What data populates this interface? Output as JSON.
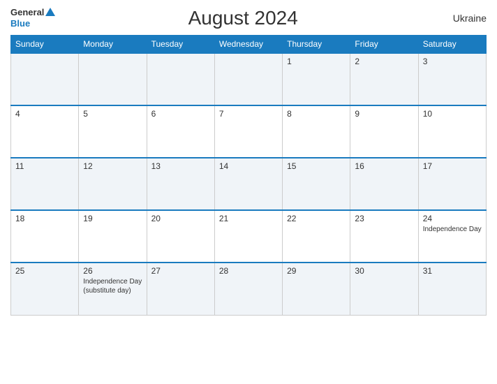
{
  "header": {
    "logo_general": "General",
    "logo_blue": "Blue",
    "title": "August 2024",
    "country": "Ukraine"
  },
  "days_of_week": [
    "Sunday",
    "Monday",
    "Tuesday",
    "Wednesday",
    "Thursday",
    "Friday",
    "Saturday"
  ],
  "weeks": [
    {
      "days": [
        {
          "num": "",
          "empty": true
        },
        {
          "num": "",
          "empty": true
        },
        {
          "num": "",
          "empty": true
        },
        {
          "num": "",
          "empty": true
        },
        {
          "num": "1",
          "event": ""
        },
        {
          "num": "2",
          "event": ""
        },
        {
          "num": "3",
          "event": ""
        }
      ]
    },
    {
      "days": [
        {
          "num": "4",
          "event": ""
        },
        {
          "num": "5",
          "event": ""
        },
        {
          "num": "6",
          "event": ""
        },
        {
          "num": "7",
          "event": ""
        },
        {
          "num": "8",
          "event": ""
        },
        {
          "num": "9",
          "event": ""
        },
        {
          "num": "10",
          "event": ""
        }
      ]
    },
    {
      "days": [
        {
          "num": "11",
          "event": ""
        },
        {
          "num": "12",
          "event": ""
        },
        {
          "num": "13",
          "event": ""
        },
        {
          "num": "14",
          "event": ""
        },
        {
          "num": "15",
          "event": ""
        },
        {
          "num": "16",
          "event": ""
        },
        {
          "num": "17",
          "event": ""
        }
      ]
    },
    {
      "days": [
        {
          "num": "18",
          "event": ""
        },
        {
          "num": "19",
          "event": ""
        },
        {
          "num": "20",
          "event": ""
        },
        {
          "num": "21",
          "event": ""
        },
        {
          "num": "22",
          "event": ""
        },
        {
          "num": "23",
          "event": ""
        },
        {
          "num": "24",
          "event": "Independence Day"
        }
      ]
    },
    {
      "days": [
        {
          "num": "25",
          "event": ""
        },
        {
          "num": "26",
          "event": "Independence Day (substitute day)"
        },
        {
          "num": "27",
          "event": ""
        },
        {
          "num": "28",
          "event": ""
        },
        {
          "num": "29",
          "event": ""
        },
        {
          "num": "30",
          "event": ""
        },
        {
          "num": "31",
          "event": ""
        }
      ]
    }
  ]
}
